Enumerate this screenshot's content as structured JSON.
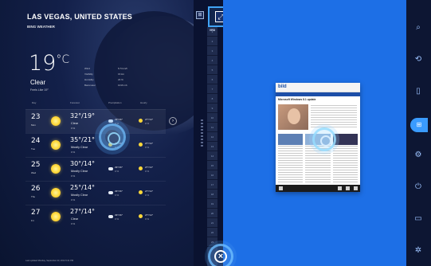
{
  "weather": {
    "city": "LAS VEGAS, UNITED STATES",
    "source": "BING WEATHER",
    "temp": "19",
    "unit": "°C",
    "condition": "Clear",
    "feels_like": "Feels Like 19°",
    "details": [
      "Wind",
      "N 5 km/h",
      "Visibility",
      "16 km",
      "Humidity",
      "24 %",
      "Barometer",
      "1016 mb"
    ],
    "col_headers": [
      "Day",
      "Forecast",
      "Precipitation",
      "Hourly"
    ],
    "days": [
      {
        "date": "23",
        "dow": "Mon",
        "hilo": "32°/19°",
        "cond": "Clear",
        "precip": "0 %",
        "h1": "29°/16°",
        "p1": "0 %",
        "h2": "27°/14°",
        "p2": "0 %"
      },
      {
        "date": "24",
        "dow": "Tue",
        "hilo": "35°/21°",
        "cond": "Mostly Clear",
        "precip": "0 %",
        "h1": "29°/16°",
        "p1": "0 %",
        "h2": "27°/14°",
        "p2": "0 %"
      },
      {
        "date": "25",
        "dow": "Wed",
        "hilo": "30°/14°",
        "cond": "Mostly Clear",
        "precip": "0 %",
        "h1": "29°/16°",
        "p1": "0 %",
        "h2": "27°/14°",
        "p2": "0 %"
      },
      {
        "date": "26",
        "dow": "Thu",
        "hilo": "25°/14°",
        "cond": "Mostly Clear",
        "precip": "0 %",
        "h1": "29°/16°",
        "p1": "0 %",
        "h2": "27°/14°",
        "p2": "0 %"
      },
      {
        "date": "27",
        "dow": "Fri",
        "hilo": "27°/14°",
        "cond": "Clear",
        "precip": "0 %",
        "h1": "29°/16°",
        "p1": "0 %",
        "h2": "27°/14°",
        "p2": "0 %"
      }
    ],
    "footer": "Last updated Monday, September 23, 2013 5:21 PM"
  },
  "strip": {
    "label": "VRD",
    "numbers": [
      "1",
      "2",
      "3",
      "4",
      "5",
      "6",
      "7",
      "8",
      "9",
      "10",
      "11",
      "12",
      "13",
      "14",
      "15",
      "16",
      "17",
      "18",
      "19",
      "20",
      "21",
      "22",
      "23"
    ]
  },
  "snapped_site": {
    "logo": "bild",
    "headline": "Microsoft Windows 8.1 update"
  },
  "charms": [
    "search-icon",
    "share-icon",
    "start-icon",
    "devices-icon",
    "settings-icon"
  ],
  "colors": {
    "accent": "#1d6fe6",
    "dark": "#0b1530",
    "charm_active": "#3a9bff"
  }
}
